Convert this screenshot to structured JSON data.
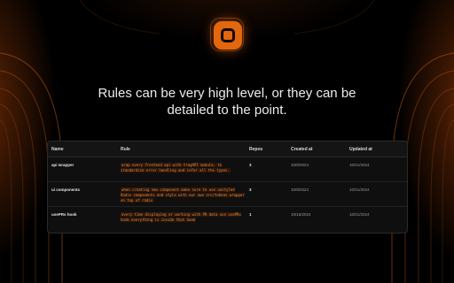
{
  "headline": "Rules can be very high level, or they can be detailed to the point.",
  "colors": {
    "accent": "#e2670f",
    "background": "#000000",
    "panel": "#0f0f10",
    "rule_text": "#e88a3a"
  },
  "logo": {
    "icon": "square-ring-icon"
  },
  "table": {
    "headers": {
      "name": "Name",
      "rule": "Rule",
      "repos": "Repos",
      "created": "Created at",
      "updated": "Updated at"
    },
    "rows": [
      {
        "name": "api wrapper",
        "rule": "wrap every frontend api with tragAPI module, to standardize error handling and infer all the types.",
        "repos": "3",
        "created": "10/9/2024",
        "updated": "10/21/2024"
      },
      {
        "name": "ui components",
        "rule": "when creating new component make sure to use unstyled Radix components and style with our own src/tokens wrapper on top of radix",
        "repos": "3",
        "created": "10/9/2024",
        "updated": "10/21/2024"
      },
      {
        "name": "usePRs hook",
        "rule": "every time displaying or working with PR data use usePRs hook everything is inside that hook",
        "repos": "1",
        "created": "10/16/2024",
        "updated": "10/21/2024"
      }
    ]
  }
}
